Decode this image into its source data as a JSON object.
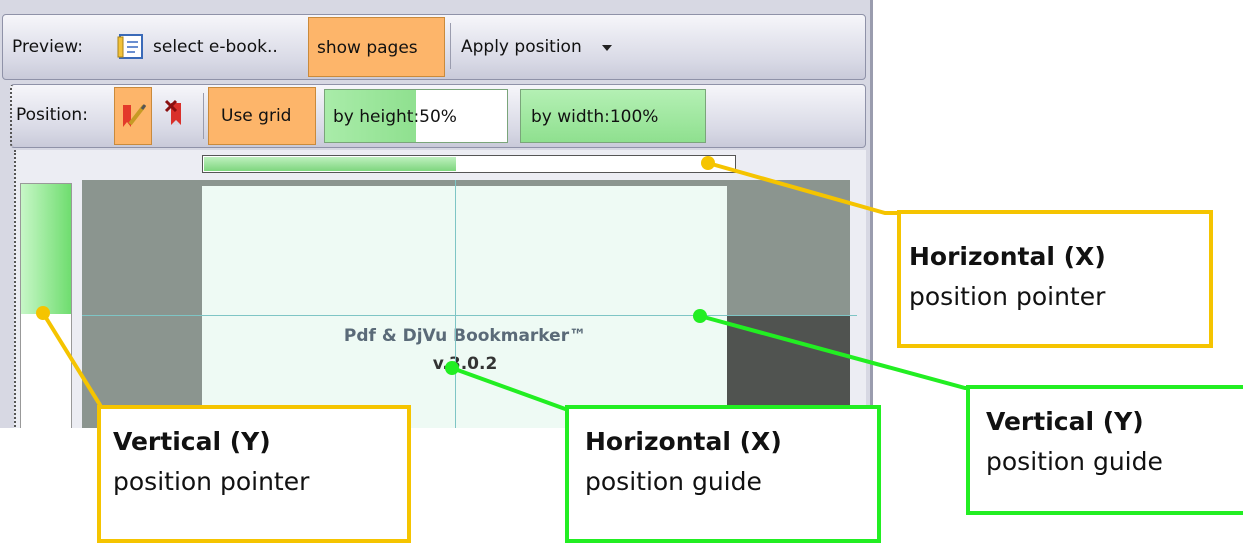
{
  "toolbar1": {
    "preview_label": "Preview:",
    "select_ebook_label": "select e-book..",
    "show_pages_label": "show pages",
    "apply_position_label": "Apply position"
  },
  "toolbar2": {
    "position_label": "Position:",
    "use_grid_label": "Use grid",
    "by_height_label": "by height:50%",
    "by_width_label": "by width:100%",
    "by_height_percent": 50,
    "by_width_percent": 100
  },
  "preview": {
    "line1": "Pdf & DjVu Bookmarker™",
    "line2": "v.3.0.2",
    "horizontal_pointer_fraction": 0.47,
    "vertical_pointer_fraction": 0.53
  },
  "callouts": [
    {
      "title": "Horizontal (X)",
      "sub": "position pointer",
      "color": "#f5c400"
    },
    {
      "title": "Vertical (Y)",
      "sub": "position guide",
      "color": "#22ee22"
    },
    {
      "title": "Vertical (Y)",
      "sub": "position pointer",
      "color": "#f5c400"
    },
    {
      "title": "Horizontal (X)",
      "sub": "position guide",
      "color": "#22ee22"
    }
  ],
  "colors": {
    "accent_orange": "#fdb56a",
    "pointer_green": "#7ed67e",
    "callout_yellow": "#f5c400",
    "callout_green": "#22ee22"
  },
  "icons": [
    "ebook-icon",
    "dropdown-arrow-icon",
    "bookmark-pencil-icon",
    "bookmark-remove-icon"
  ]
}
